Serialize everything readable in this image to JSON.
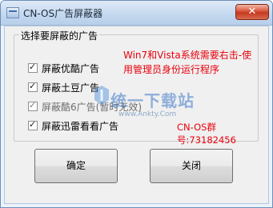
{
  "window": {
    "title": "CN-OS广告屏蔽器",
    "close_glyph": "✕"
  },
  "group": {
    "title": "选择要屏蔽的广告"
  },
  "options": [
    {
      "label": "屏蔽优酷广告",
      "checked": true,
      "enabled": true
    },
    {
      "label": "屏蔽土豆广告",
      "checked": true,
      "enabled": true
    },
    {
      "label": "屏蔽酷6广告(暂时无效)",
      "checked": true,
      "enabled": false
    },
    {
      "label": "屏蔽迅雷看看广告",
      "checked": true,
      "enabled": true
    }
  ],
  "note": "Win7和Vista系统需要右击-使用管理员身份运行程序",
  "qq_group": "CN-OS群号:73182456",
  "buttons": {
    "ok": "确定",
    "close": "关闭"
  },
  "watermark": {
    "text": "统一下载站",
    "url": "www.Ankty.Com"
  },
  "colors": {
    "note_red": "#e8000d",
    "title_bar": "#c5d9ef"
  }
}
